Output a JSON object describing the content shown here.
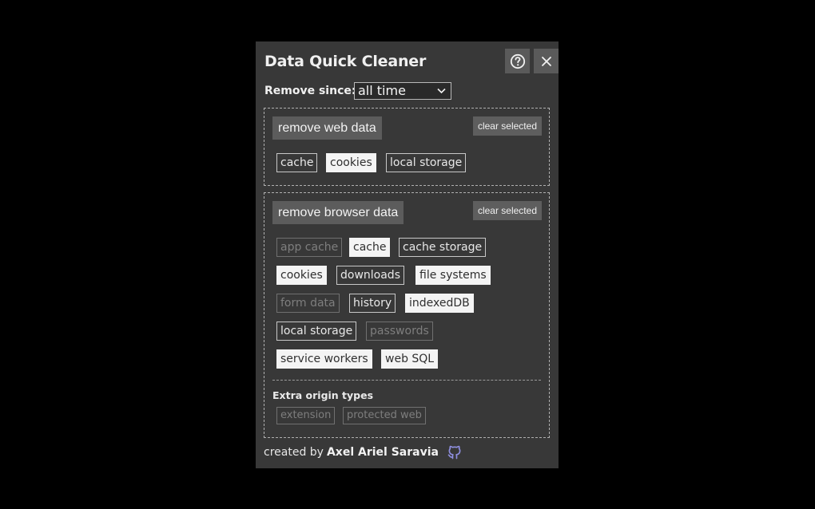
{
  "header": {
    "title": "Data Quick Cleaner",
    "help_icon": "help-circle-icon",
    "close_icon": "close-icon"
  },
  "since": {
    "label": "Remove since:",
    "selected": "all time"
  },
  "web_section": {
    "title": "remove web data",
    "clear_label": "clear selected",
    "chips": [
      {
        "label": "cache",
        "state": "off"
      },
      {
        "label": "cookies",
        "state": "on"
      },
      {
        "label": "local storage",
        "state": "off"
      }
    ]
  },
  "browser_section": {
    "title": "remove browser data",
    "clear_label": "clear selected",
    "chips": [
      {
        "label": "app cache",
        "state": "disabled"
      },
      {
        "label": "cache",
        "state": "on"
      },
      {
        "label": "cache storage",
        "state": "off"
      },
      {
        "label": "cookies",
        "state": "on"
      },
      {
        "label": "downloads",
        "state": "off"
      },
      {
        "label": "file systems",
        "state": "on"
      },
      {
        "label": "form data",
        "state": "disabled"
      },
      {
        "label": "history",
        "state": "off"
      },
      {
        "label": "indexedDB",
        "state": "on"
      },
      {
        "label": "local storage",
        "state": "off"
      },
      {
        "label": "passwords",
        "state": "disabled"
      },
      {
        "label": "service workers",
        "state": "on"
      },
      {
        "label": "web SQL",
        "state": "on"
      }
    ],
    "extra_title": "Extra origin types",
    "extra_chips": [
      {
        "label": "extension",
        "state": "disabled"
      },
      {
        "label": "protected web",
        "state": "disabled"
      }
    ]
  },
  "footer": {
    "prefix": "created by",
    "author": "Axel Ariel Saravia",
    "icon": "github-icon"
  },
  "colors": {
    "background": "#000000",
    "panel": "#383838",
    "button": "#5c5c5c",
    "chip_on": "#f4f4f4",
    "github_icon": "#8f8fe0"
  }
}
